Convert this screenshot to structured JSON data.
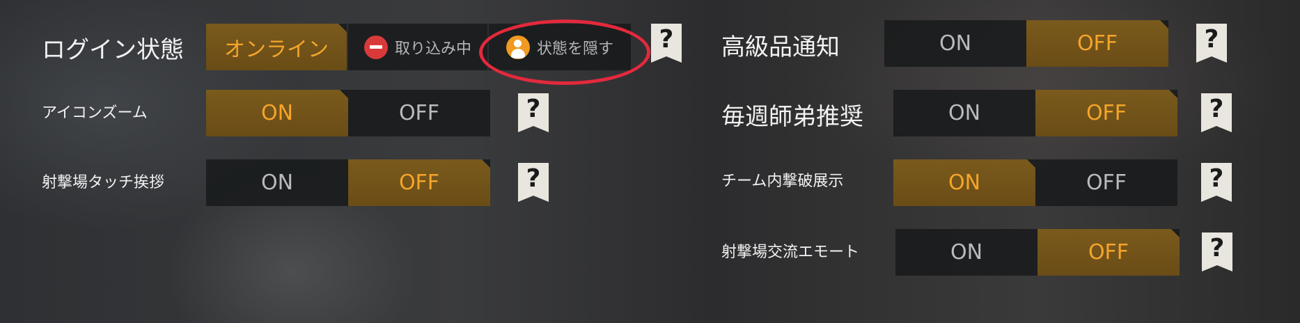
{
  "login_status": {
    "label": "ログイン状態",
    "options": [
      "オンライン",
      "取り込み中",
      "状態を隠す"
    ],
    "selected": "オンライン"
  },
  "icon_zoom": {
    "label": "アイコンズーム",
    "on": "ON",
    "off": "OFF",
    "selected": "ON"
  },
  "range_greeting": {
    "label": "射撃場タッチ挨拶",
    "on": "ON",
    "off": "OFF",
    "selected": "OFF"
  },
  "luxury_notice": {
    "label": "高級品通知",
    "on": "ON",
    "off": "OFF",
    "selected": "OFF"
  },
  "weekly_mentor": {
    "label": "毎週師弟推奨",
    "on": "ON",
    "off": "OFF",
    "selected": "OFF"
  },
  "team_kill_display": {
    "label": "チーム内撃破展示",
    "on": "ON",
    "off": "OFF",
    "selected": "ON"
  },
  "range_emote": {
    "label": "射撃場交流エモート",
    "on": "ON",
    "off": "OFF",
    "selected": "OFF"
  },
  "help_symbol": "?",
  "colors": {
    "accent": "#f5a52a",
    "selected_bg": "#6a4c16",
    "highlight": "#e3293d"
  }
}
